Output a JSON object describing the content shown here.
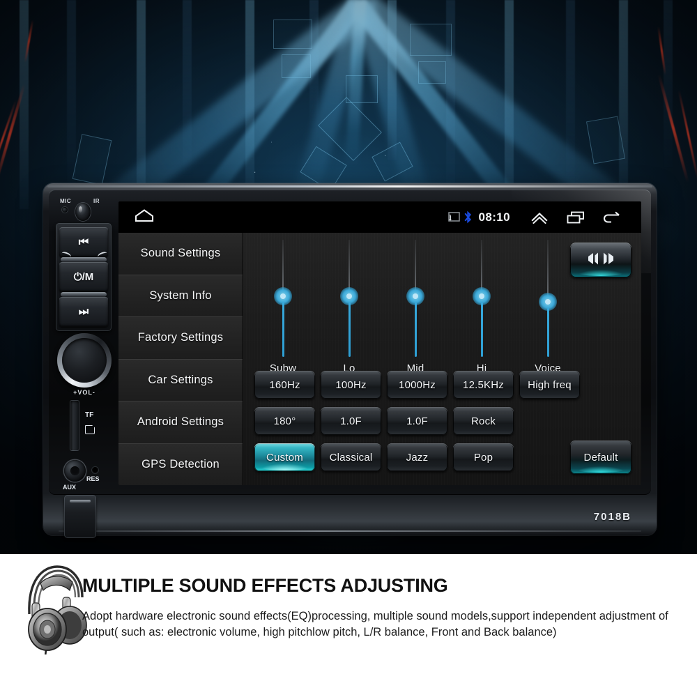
{
  "device": {
    "model_label": "7018B",
    "hw_controls": {
      "mic_label": "MIC",
      "ir_label": "IR",
      "prev_button": "⏮",
      "power_mode_button": "⏻/M",
      "next_button": "⏭",
      "volume_label": "+VOL-",
      "tf_label": "TF",
      "aux_label": "AUX",
      "res_label": "RES"
    }
  },
  "statusbar": {
    "home_icon": "home-icon",
    "cast_icon": "cast-icon",
    "bluetooth_icon": "bluetooth-icon",
    "time": "08:10",
    "chevron_up_icon": "chevron-up-icon",
    "recents_icon": "recents-icon",
    "back_icon": "back-arrow-icon"
  },
  "sidebar": {
    "items": [
      {
        "label": "Sound Settings"
      },
      {
        "label": "System Info"
      },
      {
        "label": "Factory Settings"
      },
      {
        "label": "Car Settings"
      },
      {
        "label": "Android Settings"
      },
      {
        "label": "GPS Detection"
      }
    ]
  },
  "equalizer": {
    "sliders": [
      {
        "label": "Subw",
        "value": 50
      },
      {
        "label": "Lo",
        "value": 50
      },
      {
        "label": "Mid",
        "value": 50
      },
      {
        "label": "Hi",
        "value": 50
      },
      {
        "label": "Voice",
        "value": 45
      }
    ],
    "balance_button": {
      "icon": "balance-fader-icon"
    },
    "row1": [
      {
        "label": "160Hz"
      },
      {
        "label": "100Hz"
      },
      {
        "label": "1000Hz"
      },
      {
        "label": "12.5KHz"
      },
      {
        "label": "High freq"
      }
    ],
    "row2": [
      {
        "label": "180°"
      },
      {
        "label": "1.0F"
      },
      {
        "label": "1.0F"
      },
      {
        "label": "Rock"
      }
    ],
    "row3": [
      {
        "label": "Custom",
        "state": "active"
      },
      {
        "label": "Classical",
        "state": "normal"
      },
      {
        "label": "Jazz",
        "state": "normal"
      },
      {
        "label": "Pop",
        "state": "normal"
      }
    ],
    "default_button": {
      "label": "Default"
    }
  },
  "promo": {
    "headphones_icon": "headphones-photo",
    "title": "MULTIPLE SOUND EFFECTS ADJUSTING",
    "body": "Adopt hardware electronic sound effects(EQ)processing, multiple sound models,support independent adjustment of output( such as: electronic volume, high pitchlow pitch, L/R balance, Front and Back balance)"
  },
  "colors": {
    "accent_cyan": "#3aa8d8",
    "highlight_teal": "#2fdede",
    "bluetooth_blue": "#1a4be0",
    "screen_bg": "#1b1b1b",
    "nav_bg": "#232323"
  }
}
